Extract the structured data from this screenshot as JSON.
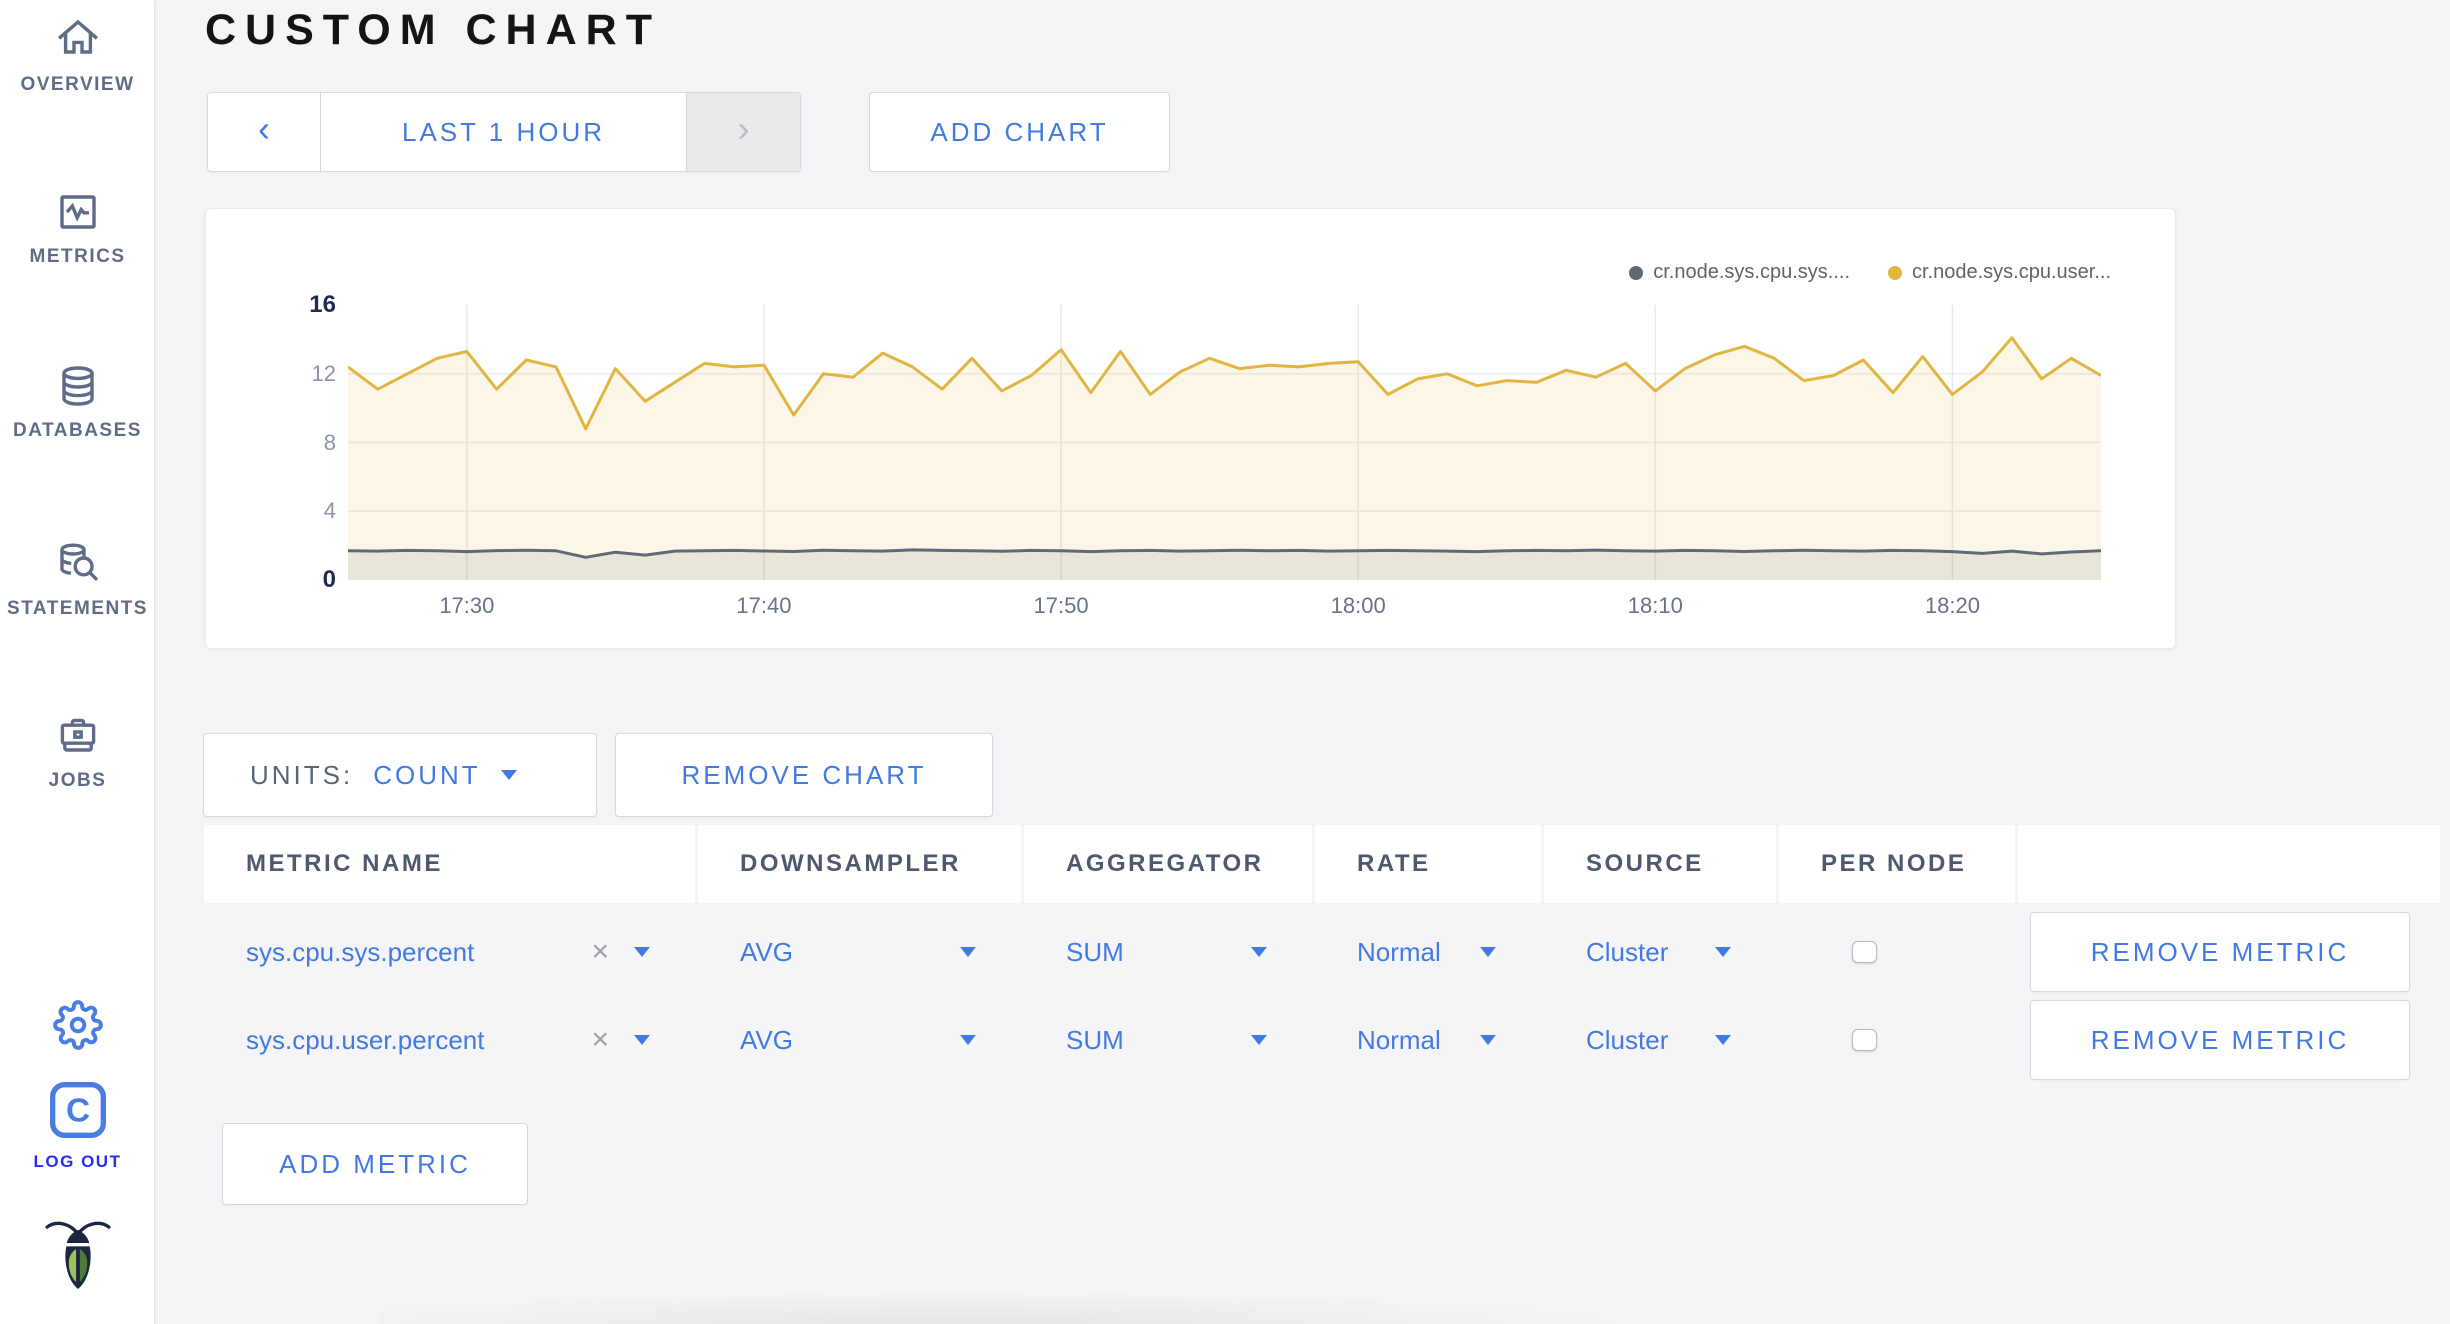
{
  "sidebar": {
    "items": [
      {
        "label": "OVERVIEW"
      },
      {
        "label": "METRICS"
      },
      {
        "label": "DATABASES"
      },
      {
        "label": "STATEMENTS"
      },
      {
        "label": "JOBS"
      }
    ],
    "logout_label": "LOG OUT"
  },
  "header": {
    "title": "CUSTOM CHART"
  },
  "time_selector": {
    "label": "LAST 1 HOUR",
    "prev": "‹",
    "next": "›"
  },
  "add_chart_label": "ADD CHART",
  "units": {
    "label": "UNITS:",
    "value": "COUNT"
  },
  "remove_chart_label": "REMOVE CHART",
  "add_metric_label": "ADD METRIC",
  "chart_data": {
    "type": "line",
    "title": "",
    "xlabel": "",
    "ylabel": "",
    "ylim": [
      0,
      16
    ],
    "y_ticks": [
      16,
      12,
      8,
      4,
      0
    ],
    "y_gridlines": [
      12,
      8,
      4
    ],
    "x_ticks": [
      "17:30",
      "17:40",
      "17:50",
      "18:00",
      "18:10",
      "18:20"
    ],
    "x_start": "17:26",
    "x_end": "18:25",
    "x_interval_minutes": 1,
    "grid": true,
    "legend_position": "top-right",
    "area_fill_opacity": 0.12,
    "series": [
      {
        "name": "cr.node.sys.cpu.sys....",
        "color": "#606a77",
        "values": [
          1.7,
          1.68,
          1.72,
          1.7,
          1.65,
          1.71,
          1.73,
          1.7,
          1.32,
          1.62,
          1.45,
          1.68,
          1.7,
          1.72,
          1.69,
          1.66,
          1.73,
          1.7,
          1.68,
          1.75,
          1.72,
          1.7,
          1.67,
          1.72,
          1.7,
          1.65,
          1.7,
          1.72,
          1.68,
          1.7,
          1.73,
          1.7,
          1.72,
          1.68,
          1.7,
          1.72,
          1.7,
          1.68,
          1.65,
          1.7,
          1.72,
          1.7,
          1.74,
          1.7,
          1.68,
          1.72,
          1.7,
          1.66,
          1.7,
          1.73,
          1.7,
          1.68,
          1.72,
          1.7,
          1.65,
          1.55,
          1.68,
          1.52,
          1.63,
          1.7
        ]
      },
      {
        "name": "cr.node.sys.cpu.user...",
        "color": "#e2b542",
        "values": [
          12.4,
          11.1,
          12.0,
          12.9,
          13.3,
          11.1,
          12.8,
          12.4,
          8.8,
          12.3,
          10.4,
          11.5,
          12.6,
          12.4,
          12.5,
          9.6,
          12.0,
          11.8,
          13.2,
          12.4,
          11.1,
          12.9,
          11.0,
          11.9,
          13.4,
          10.9,
          13.3,
          10.8,
          12.1,
          12.9,
          12.3,
          12.5,
          12.4,
          12.6,
          12.7,
          10.8,
          11.7,
          12.0,
          11.3,
          11.6,
          11.5,
          12.2,
          11.8,
          12.6,
          11.0,
          12.3,
          13.1,
          13.6,
          12.9,
          11.6,
          11.9,
          12.8,
          10.9,
          13.0,
          10.8,
          12.1,
          14.1,
          11.7,
          12.9,
          11.9
        ]
      }
    ]
  },
  "metrics_table": {
    "columns": [
      "METRIC NAME",
      "DOWNSAMPLER",
      "AGGREGATOR",
      "RATE",
      "SOURCE",
      "PER NODE",
      ""
    ],
    "rows": [
      {
        "metric_name": "sys.cpu.sys.percent",
        "downsampler": "AVG",
        "aggregator": "SUM",
        "rate": "Normal",
        "source": "Cluster",
        "per_node_checked": false,
        "remove_label": "REMOVE METRIC"
      },
      {
        "metric_name": "sys.cpu.user.percent",
        "downsampler": "AVG",
        "aggregator": "SUM",
        "rate": "Normal",
        "source": "Cluster",
        "per_node_checked": false,
        "remove_label": "REMOVE METRIC"
      }
    ]
  },
  "colors": {
    "accent_blue": "#4379e2",
    "logout_blue": "#2430f0",
    "sidebar_text": "#5f6c87",
    "page_bg": "#f5f5f7",
    "series_sys": "#606a77",
    "series_user": "#e2b542"
  }
}
